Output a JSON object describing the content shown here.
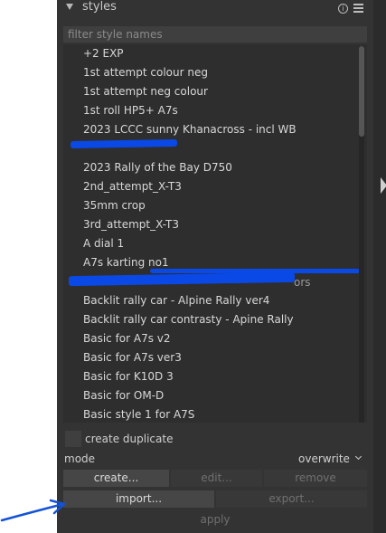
{
  "module": {
    "title": "styles"
  },
  "filter": {
    "placeholder": "filter style names",
    "value": ""
  },
  "styles_list": [
    "+2 EXP",
    "1st attempt colour neg",
    "1st attempt neg colour",
    "1st roll HP5+ A7s",
    "2023 LCCC sunny Khanacross - incl WB",
    "",
    "2023 Rally of the Bay D750",
    "2nd_attempt_X-T3",
    "35mm crop",
    "3rd_attempt_X-T3",
    "A dial 1",
    "A7s karting no1",
    "",
    "Backlit rally car - Alpine Rally ver4",
    "Backlit rally car contrasty - Apine Rally",
    "Basic for A7s v2",
    "Basic for A7s ver3",
    "Basic for K10D 3",
    "Basic for OM-D",
    "Basic style 1 for A7S"
  ],
  "partial_text": "ors",
  "options": {
    "create_duplicate_label": "create duplicate",
    "create_duplicate_checked": false
  },
  "mode": {
    "label": "mode",
    "value": "overwrite"
  },
  "buttons": {
    "create": "create...",
    "edit": "edit...",
    "remove": "remove",
    "import": "import...",
    "export": "export...",
    "apply": "apply"
  },
  "colors": {
    "panel_bg": "#333333",
    "list_bg": "#2e2e2e",
    "redaction": "#0a49e6",
    "annotation_arrow": "#1453d6"
  },
  "icons": [
    "collapse-triangle-icon",
    "info-icon",
    "menu-icon",
    "expand-right-arrow-icon",
    "annotation-arrow-icon"
  ]
}
